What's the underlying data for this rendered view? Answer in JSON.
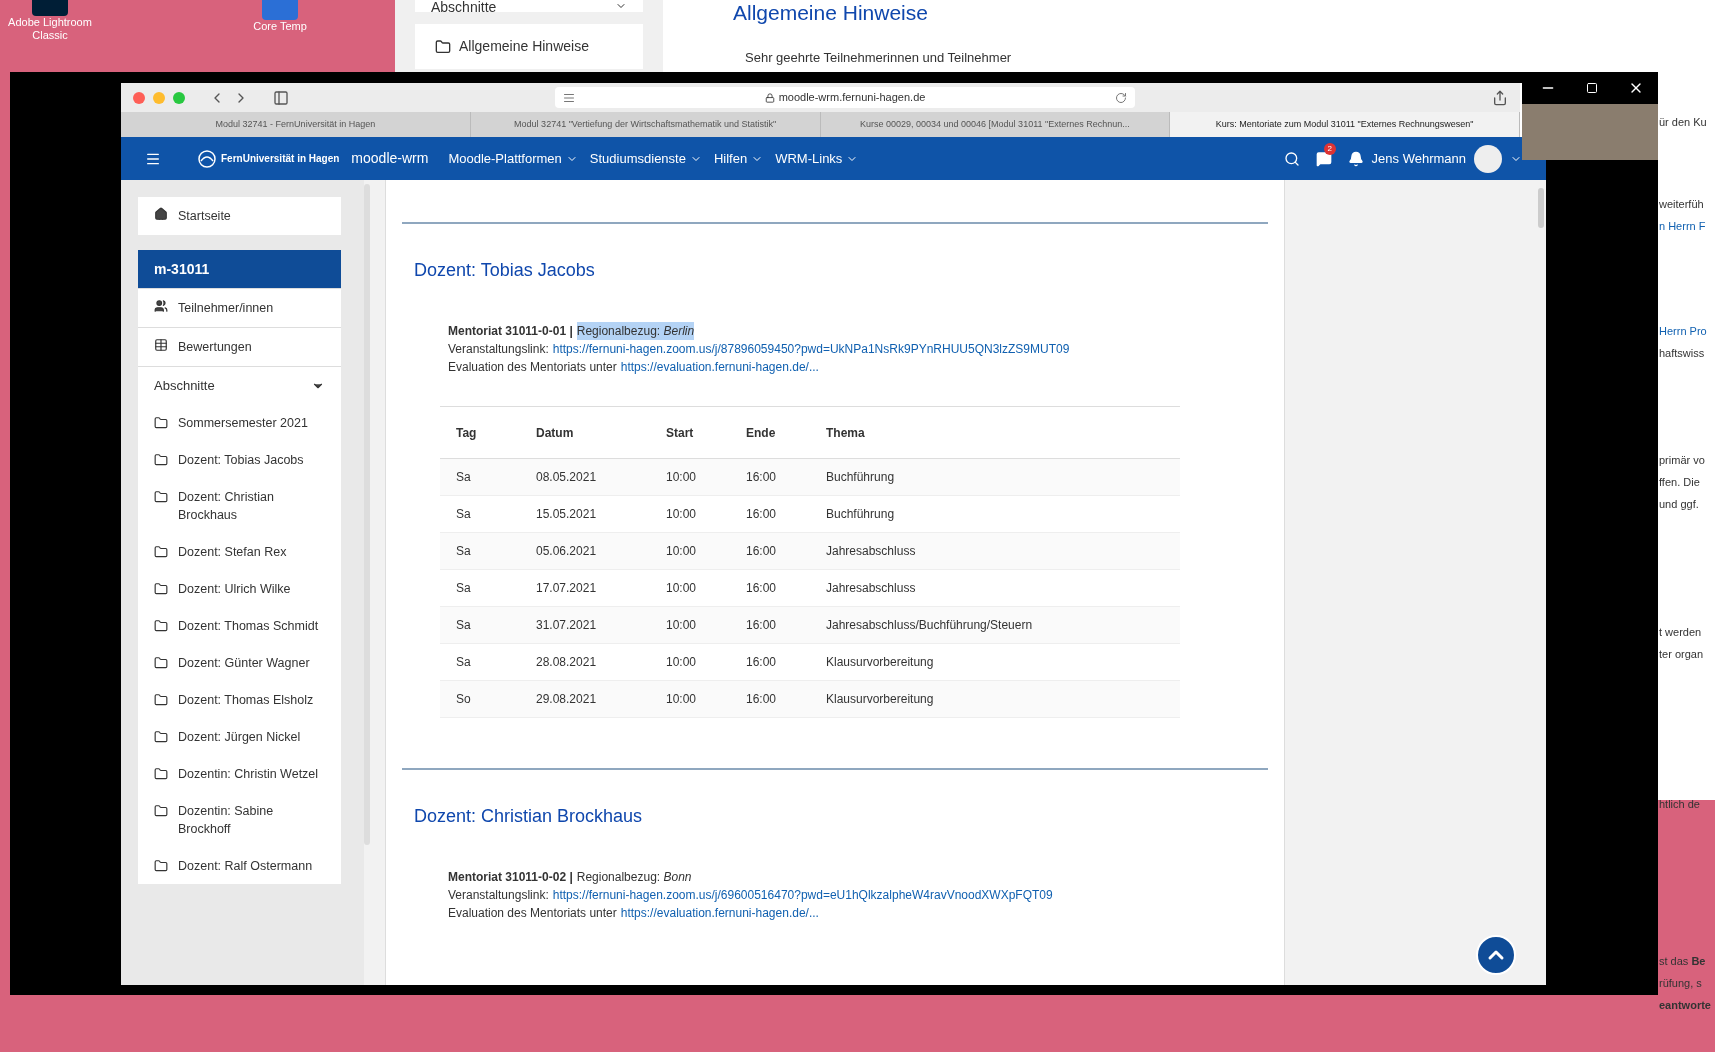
{
  "desktop_icons": [
    {
      "label": "Adobe Lightroom Classic"
    },
    {
      "label": "Core Temp"
    }
  ],
  "background_window": {
    "sidebar_items": [
      {
        "label": "Abschnitte",
        "kind": "header"
      },
      {
        "label": "Allgemeine Hinweise",
        "kind": "folder"
      }
    ],
    "heading": "Allgemeine Hinweise",
    "intro": "Sehr geehrte Teilnehmerinnen und Teilnehmer",
    "fragments": [
      [
        {
          "text": "ür den Ku",
          "link": false
        }
      ],
      [
        {
          "text": "weiterfüh",
          "link": false
        },
        {
          "text": "n Herrn F",
          "link": true
        }
      ],
      [
        {
          "text": "Herrn Pro",
          "link": true
        },
        {
          "text": "haftswiss",
          "link": false
        }
      ],
      [
        {
          "text": "primär vo",
          "link": false
        },
        {
          "text": "ffen. Die",
          "link": false
        },
        {
          "text": "und ggf.",
          "link": false
        }
      ],
      [
        {
          "text": "t werden",
          "link": false
        },
        {
          "text": "ter organ",
          "link": false
        }
      ],
      [
        {
          "text": "htlich de",
          "link": false
        }
      ],
      [
        {
          "text": "st das **Be**",
          "link": false
        },
        {
          "text": "rüfung, s",
          "link": false
        },
        {
          "text": "**eantworte**",
          "link": false
        }
      ]
    ]
  },
  "browser": {
    "url": "moodle-wrm.fernuni-hagen.de",
    "tabs": [
      {
        "label": "Modul 32741 - FernUniversität in Hagen",
        "selected": false
      },
      {
        "label": "Modul 32741 \"Vertiefung der Wirtschaftsmathematik und Statistik\"",
        "selected": false
      },
      {
        "label": "Kurse 00029, 00034 und 00046 [Modul 31011 \"Externes Rechnun...",
        "selected": false
      },
      {
        "label": "Kurs: Mentoriate zum Modul 31011 \"Externes Rechnungswesen\"",
        "selected": true
      }
    ],
    "navbar": {
      "logo_text": "FernUniversität in Hagen",
      "site": "moodle-wrm",
      "menus": [
        "Moodle-Plattformen",
        "Studiumsdienste",
        "Hilfen",
        "WRM-Links"
      ],
      "message_count": "2",
      "user": "Jens Wehrmann"
    },
    "sidebar": [
      {
        "label": "Startseite",
        "kind": "home",
        "selected": false
      },
      {
        "label": "m-31011",
        "kind": "course",
        "selected": true
      },
      {
        "label": "Teilnehmer/innen",
        "kind": "users",
        "selected": false
      },
      {
        "label": "Bewertungen",
        "kind": "grades",
        "selected": false
      },
      {
        "label": "Abschnitte",
        "kind": "header"
      },
      {
        "label": "Sommersemester 2021",
        "kind": "folder",
        "selected": false
      },
      {
        "label": "Dozent: Tobias Jacobs",
        "kind": "folder",
        "selected": false
      },
      {
        "label": "Dozent: Christian Brockhaus",
        "kind": "folder",
        "selected": false
      },
      {
        "label": "Dozent: Stefan Rex",
        "kind": "folder",
        "selected": false
      },
      {
        "label": "Dozent: Ulrich Wilke",
        "kind": "folder",
        "selected": false
      },
      {
        "label": "Dozent: Thomas Schmidt",
        "kind": "folder",
        "selected": false
      },
      {
        "label": "Dozent: Günter Wagner",
        "kind": "folder",
        "selected": false
      },
      {
        "label": "Dozent: Thomas Elsholz",
        "kind": "folder",
        "selected": false
      },
      {
        "label": "Dozent: Jürgen Nickel",
        "kind": "folder",
        "selected": false
      },
      {
        "label": "Dozentin: Christin Wetzel",
        "kind": "folder",
        "selected": false
      },
      {
        "label": "Dozentin: Sabine Brockhoff",
        "kind": "folder",
        "selected": false
      },
      {
        "label": "Dozent: Ralf Ostermann",
        "kind": "folder",
        "selected": false
      }
    ],
    "sections": [
      {
        "heading": "Dozent: Tobias Jacobs",
        "mentoriat": "Mentoriat 31011-0-01 |",
        "region": "Regionalbezug: *Berlin*",
        "region_highlighted": true,
        "link_label": "Veranstaltungslink:",
        "link": "https://fernuni-hagen.zoom.us/j/87896059450?pwd=UkNPa1NsRk9PYnRHUU5QN3lzZS9MUT09",
        "eval_label": "Evaluation des Mentoriats unter",
        "eval_link": "https://evaluation.fernuni-hagen.de/...",
        "table": {
          "columns": [
            "Tag",
            "Datum",
            "Start",
            "Ende",
            "Thema"
          ],
          "rows": [
            [
              "Sa",
              "08.05.2021",
              "10:00",
              "16:00",
              "Buchführung"
            ],
            [
              "Sa",
              "15.05.2021",
              "10:00",
              "16:00",
              "Buchführung"
            ],
            [
              "Sa",
              "05.06.2021",
              "10:00",
              "16:00",
              "Jahresabschluss"
            ],
            [
              "Sa",
              "17.07.2021",
              "10:00",
              "16:00",
              "Jahresabschluss"
            ],
            [
              "Sa",
              "31.07.2021",
              "10:00",
              "16:00",
              "Jahresabschluss/Buchführung/Steuern"
            ],
            [
              "Sa",
              "28.08.2021",
              "10:00",
              "16:00",
              "Klausurvorbereitung"
            ],
            [
              "So",
              "29.08.2021",
              "10:00",
              "16:00",
              "Klausurvorbereitung"
            ]
          ]
        }
      },
      {
        "heading": "Dozent: Christian Brockhaus",
        "mentoriat": "Mentoriat 31011-0-02 |",
        "region": "Regionalbezug: *Bonn*",
        "region_highlighted": false,
        "link_label": "Veranstaltungslink:",
        "link": "https://fernuni-hagen.zoom.us/j/69600516470?pwd=eU1hQlkzalpheW4ravVnoodXWXpFQT09",
        "eval_label": "Evaluation des Mentoriats unter",
        "eval_link": "https://evaluation.fernuni-hagen.de/..."
      }
    ]
  }
}
